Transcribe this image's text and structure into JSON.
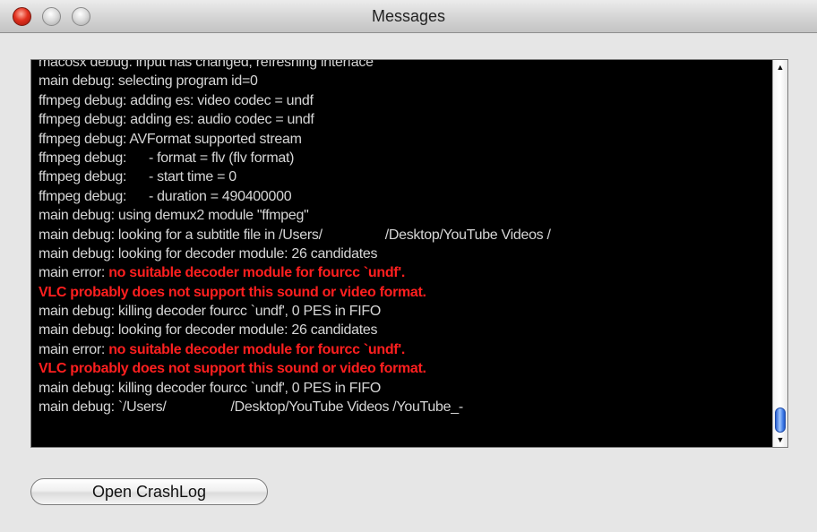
{
  "window": {
    "title": "Messages"
  },
  "log": {
    "lines": [
      {
        "text": "macosx debug: input has changed, refreshing interface",
        "color": "gray"
      },
      {
        "text": "main debug: selecting program id=0",
        "color": "gray"
      },
      {
        "text": "ffmpeg debug: adding es: video codec = undf",
        "color": "gray"
      },
      {
        "text": "ffmpeg debug: adding es: audio codec = undf",
        "color": "gray"
      },
      {
        "text": "ffmpeg debug: AVFormat supported stream",
        "color": "gray"
      },
      {
        "text": "ffmpeg debug:      - format = flv (flv format)",
        "color": "gray"
      },
      {
        "text": "ffmpeg debug:      - start time = 0",
        "color": "gray"
      },
      {
        "text": "ffmpeg debug:      - duration = 490400000",
        "color": "gray"
      },
      {
        "text": "main debug: using demux2 module \"ffmpeg\"",
        "color": "gray"
      },
      {
        "text": "main debug: looking for a subtitle file in /Users/",
        "color": "gray",
        "suffix": "/Desktop/YouTube Videos /"
      },
      {
        "text": "main debug: looking for decoder module: 26 candidates",
        "color": "gray"
      },
      {
        "text": "main error: ",
        "color": "gray",
        "red": "no suitable decoder module for fourcc `undf'."
      },
      {
        "text": "",
        "color": "gray",
        "red": "VLC probably does not support this sound or video format."
      },
      {
        "text": "main debug: killing decoder fourcc `undf', 0 PES in FIFO",
        "color": "gray"
      },
      {
        "text": "main debug: looking for decoder module: 26 candidates",
        "color": "gray"
      },
      {
        "text": "main error: ",
        "color": "gray",
        "red": "no suitable decoder module for fourcc `undf'."
      },
      {
        "text": "",
        "color": "gray",
        "red": "VLC probably does not support this sound or video format."
      },
      {
        "text": "main debug: killing decoder fourcc `undf', 0 PES in FIFO",
        "color": "gray"
      },
      {
        "text": "main debug: `/Users/",
        "color": "gray",
        "suffix": "/Desktop/YouTube Videos /YouTube_-"
      }
    ]
  },
  "buttons": {
    "open_crashlog": "Open CrashLog"
  },
  "icons": {
    "scroll_up": "▲",
    "scroll_down": "▼"
  },
  "colors": {
    "log_text": "#d6d6d6",
    "log_error": "#ff1f1f",
    "console_bg": "#000000"
  }
}
